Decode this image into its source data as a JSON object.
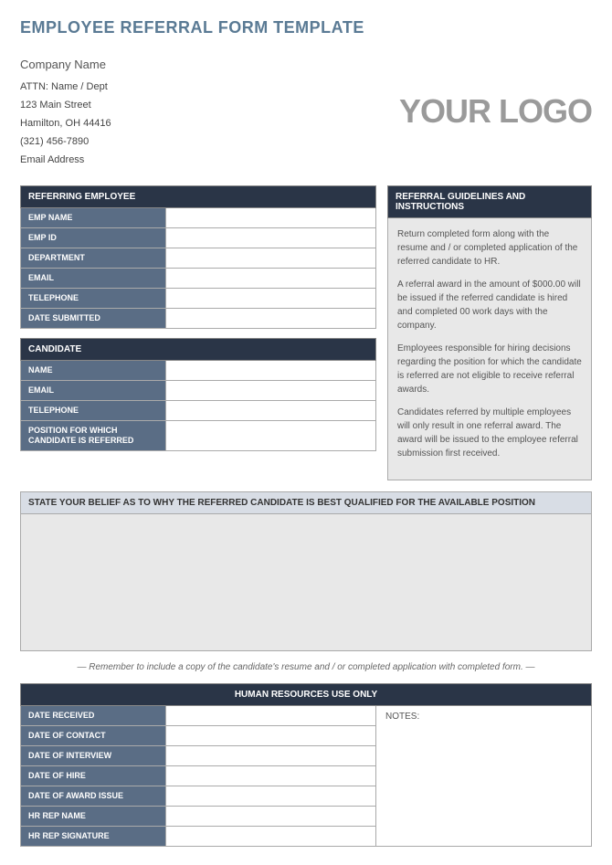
{
  "title": "EMPLOYEE REFERRAL FORM TEMPLATE",
  "company": {
    "name": "Company Name",
    "attn": "ATTN: Name / Dept",
    "street": "123 Main Street",
    "citystate": "Hamilton, OH  44416",
    "phone": "(321) 456-7890",
    "email": "Email Address"
  },
  "logo": "YOUR LOGO",
  "sections": {
    "referring": {
      "heading": "REFERRING EMPLOYEE",
      "fields": {
        "emp_name": "EMP NAME",
        "emp_id": "EMP ID",
        "department": "DEPARTMENT",
        "email": "EMAIL",
        "telephone": "TELEPHONE",
        "date_submitted": "DATE SUBMITTED"
      }
    },
    "candidate": {
      "heading": "CANDIDATE",
      "fields": {
        "name": "NAME",
        "email": "EMAIL",
        "telephone": "TELEPHONE",
        "position": "POSITION FOR WHICH CANDIDATE IS REFERRED"
      }
    },
    "guidelines": {
      "heading": "REFERRAL GUIDELINES AND INSTRUCTIONS",
      "p1": "Return completed form along with the resume and / or completed application of the referred candidate to HR.",
      "p2": "A referral award in the amount of $000.00 will be issued if the referred candidate is hired and completed 00 work days with the company.",
      "p3": "Employees responsible for hiring decisions regarding the position for which the candidate is referred are not eligible to receive referral awards.",
      "p4": "Candidates referred by multiple employees will only result in one referral award.  The award will be issued to the employee referral submission first received."
    },
    "belief": {
      "heading": "STATE YOUR BELIEF AS TO WHY THE REFERRED CANDIDATE IS BEST QUALIFIED FOR THE AVAILABLE POSITION"
    },
    "reminder": "— Remember to include a copy of the candidate's resume and / or completed application with completed form. —",
    "hr": {
      "heading": "HUMAN RESOURCES USE ONLY",
      "fields": {
        "date_received": "DATE RECEIVED",
        "date_contact": "DATE OF CONTACT",
        "date_interview": "DATE OF INTERVIEW",
        "date_hire": "DATE OF HIRE",
        "date_award": "DATE OF AWARD ISSUE",
        "hr_rep_name": "HR REP NAME",
        "hr_rep_sig": "HR REP SIGNATURE"
      },
      "notes_label": "NOTES:"
    }
  }
}
